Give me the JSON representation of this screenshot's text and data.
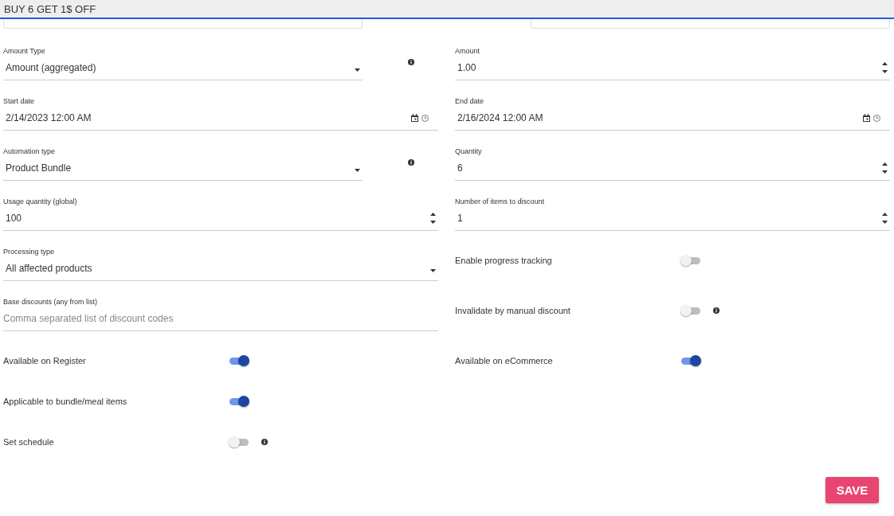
{
  "header": {
    "title": "BUY 6 GET 1$ OFF"
  },
  "rows": [
    [
      {
        "kind": "select",
        "label": "Amount Type",
        "value": "Amount (aggregated)",
        "info": true
      },
      {
        "kind": "number",
        "label": "Amount",
        "value": "1.00"
      }
    ],
    [
      {
        "kind": "date",
        "label": "Start date",
        "value": "2/14/2023 12:00 AM"
      },
      {
        "kind": "date",
        "label": "End date",
        "value": "2/16/2024 12:00 AM"
      }
    ],
    [
      {
        "kind": "select",
        "label": "Automation type",
        "value": "Product Bundle",
        "info": true
      },
      {
        "kind": "number",
        "label": "Quantity",
        "value": "6"
      }
    ],
    [
      {
        "kind": "number",
        "label": "Usage quantity (global)",
        "value": "100"
      },
      {
        "kind": "number",
        "label": "Number of items to discount",
        "value": "1"
      }
    ],
    [
      {
        "kind": "select",
        "label": "Processing type",
        "value": "All affected products"
      },
      {
        "kind": "toggle",
        "label": "Enable progress tracking",
        "on": false
      }
    ],
    [
      {
        "kind": "text",
        "label": "Base discounts (any from list)",
        "placeholder": "Comma separated list of discount codes"
      },
      {
        "kind": "toggle",
        "label": "Invalidate by manual discount",
        "on": false,
        "info": true
      }
    ],
    [
      {
        "kind": "toggle",
        "label": "Available on Register",
        "on": true
      },
      {
        "kind": "toggle",
        "label": "Available on eCommerce",
        "on": true
      }
    ],
    [
      {
        "kind": "toggle",
        "label": "Applicable to bundle/meal items",
        "on": true
      }
    ],
    [
      {
        "kind": "toggle",
        "label": "Set schedule",
        "on": false,
        "info": true
      }
    ]
  ],
  "save_button": "SAVE"
}
